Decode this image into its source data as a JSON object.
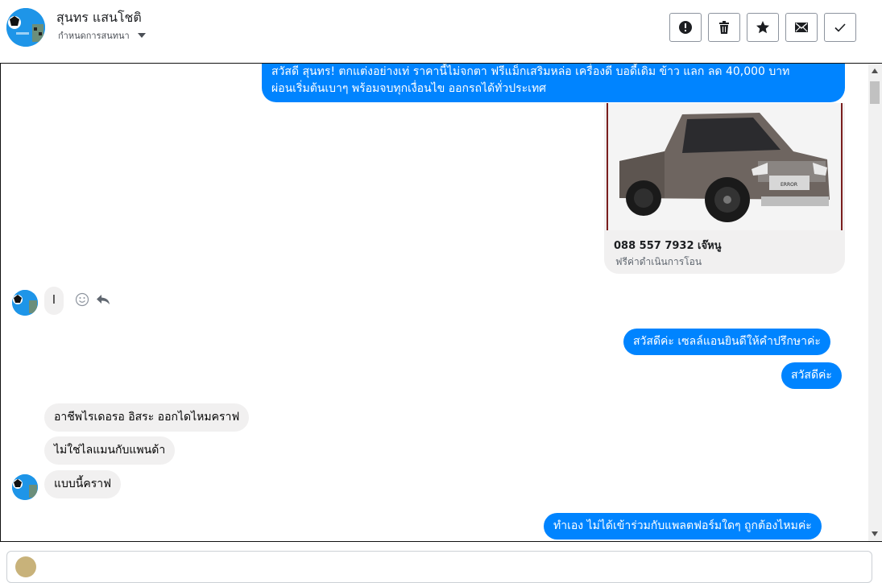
{
  "header": {
    "contact_name": "สุนทร แสนโชติ",
    "assign_label": "กำหนดการสนทนา"
  },
  "toolbar": {
    "buttons": [
      {
        "name": "report-button",
        "icon": "exclamation-circle-icon"
      },
      {
        "name": "delete-button",
        "icon": "trash-icon"
      },
      {
        "name": "star-button",
        "icon": "star-icon"
      },
      {
        "name": "mark-unread-button",
        "icon": "envelope-icon"
      },
      {
        "name": "mark-done-button",
        "icon": "check-icon"
      }
    ]
  },
  "messages": {
    "m1_line1": "สวัสดี สุนทร! ตกแต่งอย่างเท่ ราคานี้ไม่จกตา ฟรีแม็กเสริมหล่อ เครื่องดี บอดี้เดิม ข้าว แลก ลด 40,000 บาท",
    "m1_line2": "ผ่อนเริ่มต้นเบาๆ พร้อมจบทุกเงื่อนไข ออกรถได้ทั่วประเทศ",
    "card_title": "088 557 7932 เจ๊หนู",
    "card_subtitle": "ฟรีค่าดำเนินการโอน",
    "card_plate": "ERROR",
    "m2": "l",
    "m3": "สวัสดีค่ะ เซลล์แอนยินดีให้คำปรึกษาค่ะ",
    "m4": "สวัสดีค่ะ",
    "m5": "อาชีพไรเดอรอ อิสระ ออกไดไหมคราฟ",
    "m6": "ไม่ใช่ไลแมนกับแพนด้า",
    "m7": "แบบนี้คราฟ",
    "m8": "ทำเอง  ไม่ได้เข้าร่วมกับแพลตฟอร์มใดๆ ถูกต้องไหมค่ะ"
  },
  "colors": {
    "outgoing": "#0084ff",
    "incoming": "#f1f0f0",
    "avatar_bg": "#1e95e8"
  }
}
